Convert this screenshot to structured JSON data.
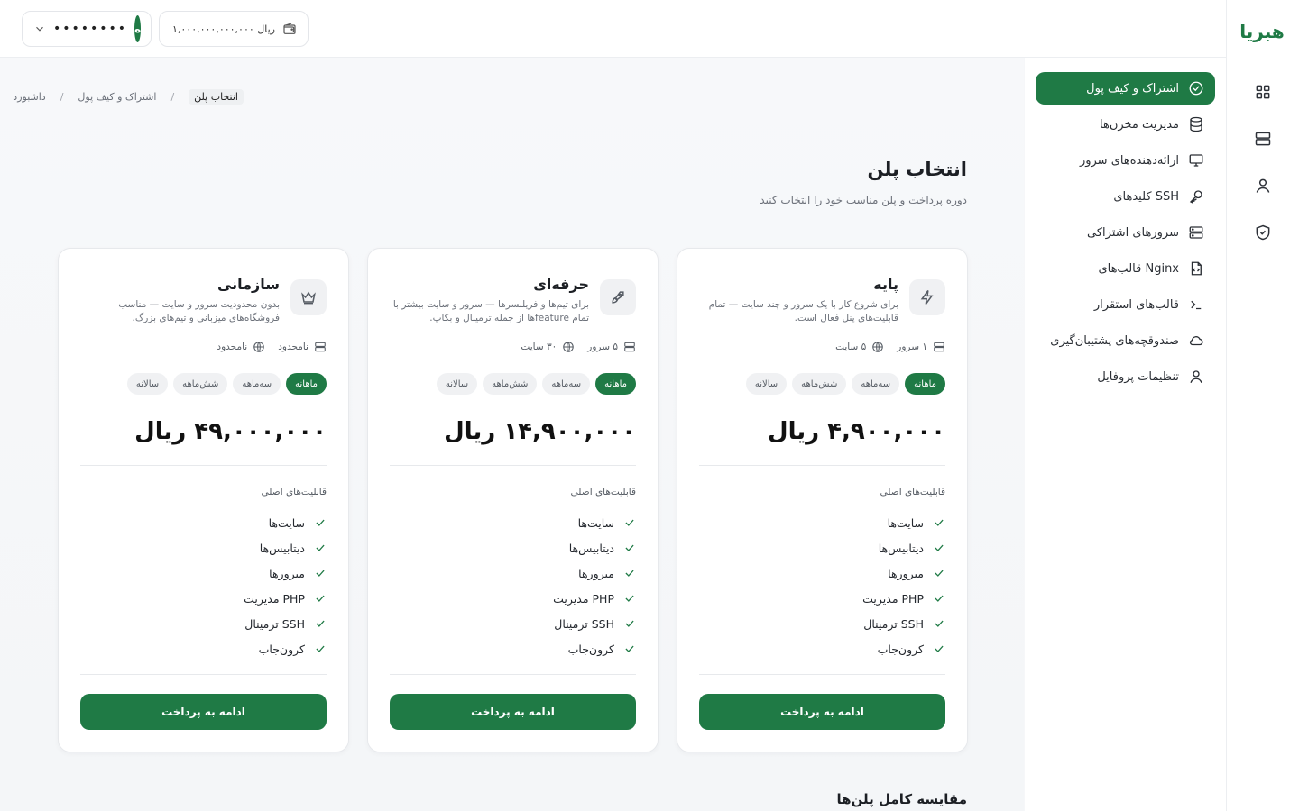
{
  "header": {
    "user_name": "••••••••",
    "user_initial": "ه",
    "wallet_balance": "۱,۰۰۰,۰۰۰,۰۰۰,۰۰۰ ریال"
  },
  "brand": {
    "logo_text": "هبریا",
    "accent": "#1f7a45"
  },
  "sidebar": {
    "items": [
      {
        "label": "اشتراک و کیف پول",
        "icon": "check-circle-icon",
        "active": true
      },
      {
        "label": "مدیریت مخزن‌ها",
        "icon": "database-icon"
      },
      {
        "label": "ارائه‌دهنده‌های سرور",
        "icon": "monitor-icon"
      },
      {
        "label": "کلیدهای SSH",
        "icon": "key-icon"
      },
      {
        "label": "سرورهای اشتراکی",
        "icon": "server-icon"
      },
      {
        "label": "قالب‌های Nginx",
        "icon": "file-code-icon"
      },
      {
        "label": "قالب‌های استقرار",
        "icon": "terminal-icon"
      },
      {
        "label": "صندوقچه‌های پشتیبان‌گیری",
        "icon": "cloud-icon"
      },
      {
        "label": "تنظیمات پروفایل",
        "icon": "user-icon"
      }
    ]
  },
  "breadcrumb": [
    "داشبورد",
    "اشتراک و کیف پول",
    "انتخاب پلن"
  ],
  "page": {
    "title": "انتخاب پلن",
    "subtitle": "دوره پرداخت و پلن مناسب خود را انتخاب کنید",
    "compare_title": "مقایسه کامل پلن‌ها"
  },
  "periods": [
    "ماهانه",
    "سه‌ماهه",
    "شش‌ماهه",
    "سالانه"
  ],
  "features_title": "قابلیت‌های اصلی",
  "features": [
    "سایت‌ها",
    "دیتابیس‌ها",
    "میرورها",
    "مدیریت PHP",
    "ترمینال SSH",
    "کرون‌جاب"
  ],
  "cta_label": "ادامه به پرداخت",
  "plans": [
    {
      "name": "پایه",
      "icon": "lightning-icon",
      "description": "برای شروع کار با یک سرور و چند سایت — تمام قابلیت‌های پنل فعال است.",
      "servers": "۱ سرور",
      "sites": "۵ سایت",
      "price": "۴,۹۰۰,۰۰۰ ریال"
    },
    {
      "name": "حرفه‌ای",
      "icon": "rocket-icon",
      "description": "برای تیم‌ها و فریلنسرها — سرور و سایت بیشتر با تمام featureها از جمله ترمینال و بکاپ.",
      "servers": "۵ سرور",
      "sites": "۳۰ سایت",
      "price": "۱۴,۹۰۰,۰۰۰ ریال"
    },
    {
      "name": "سازمانی",
      "icon": "crown-icon",
      "description": "بدون محدودیت سرور و سایت — مناسب فروشگاه‌های میزبانی و تیم‌های بزرگ.",
      "servers": "نامحدود",
      "sites": "نامحدود",
      "price": "۴۹,۰۰۰,۰۰۰ ریال"
    }
  ]
}
